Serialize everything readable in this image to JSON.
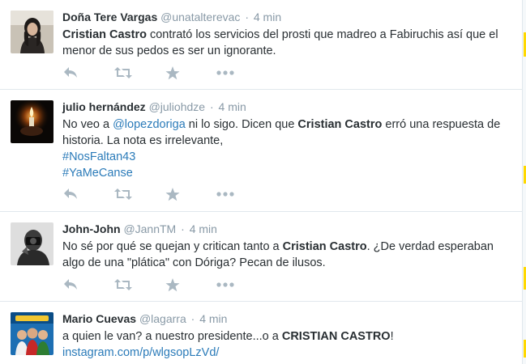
{
  "tweets": [
    {
      "fullname": "Doña Tere Vargas",
      "username": "@unatalterevac",
      "sep": "·",
      "time": "4 min",
      "text_parts": [
        {
          "t": "Cristian Castro",
          "style": "bold"
        },
        {
          "t": " contrató los servicios del prosti que madreo a Fabiruchis así que el menor de sus pedos es ser un ignorante.",
          "style": "plain"
        }
      ]
    },
    {
      "fullname": "julio hernández",
      "username": "@juliohdze",
      "sep": "·",
      "time": "4 min",
      "text_parts": [
        {
          "t": "No veo a ",
          "style": "plain"
        },
        {
          "t": "@lopezdoriga",
          "style": "link"
        },
        {
          "t": " ni lo sigo. Dicen que ",
          "style": "plain"
        },
        {
          "t": "Cristian Castro",
          "style": "bold"
        },
        {
          "t": " erró una respuesta de historia. La nota es irrelevante,",
          "style": "plain"
        }
      ],
      "hashtags": [
        "#NosFaltan43",
        "#YaMeCanse"
      ]
    },
    {
      "fullname": "John-John",
      "username": "@JannTM",
      "sep": "·",
      "time": "4 min",
      "text_parts": [
        {
          "t": "No sé por qué se quejan y critican tanto a ",
          "style": "plain"
        },
        {
          "t": "Cristian Castro",
          "style": "bold"
        },
        {
          "t": ". ¿De verdad esperaban algo de una \"plática\" con Dóriga? Pecan de ilusos.",
          "style": "plain"
        }
      ]
    },
    {
      "fullname": "Mario Cuevas",
      "username": "@lagarra",
      "sep": "·",
      "time": "4 min",
      "text_parts": [
        {
          "t": "a quien le van? a nuestro presidente...o a ",
          "style": "plain"
        },
        {
          "t": "CRISTIAN CASTRO",
          "style": "bold"
        },
        {
          "t": "!",
          "style": "plain"
        }
      ],
      "link": "instagram.com/p/wlgsopLzVd/"
    }
  ],
  "actions": [
    "reply-icon",
    "retweet-icon",
    "favorite-icon",
    "more-icon"
  ],
  "colors": {
    "link": "#2b7bb9",
    "muted": "#8899a6",
    "icon": "#aab8c2",
    "text": "#292f33",
    "divider": "#e1e8ed"
  }
}
